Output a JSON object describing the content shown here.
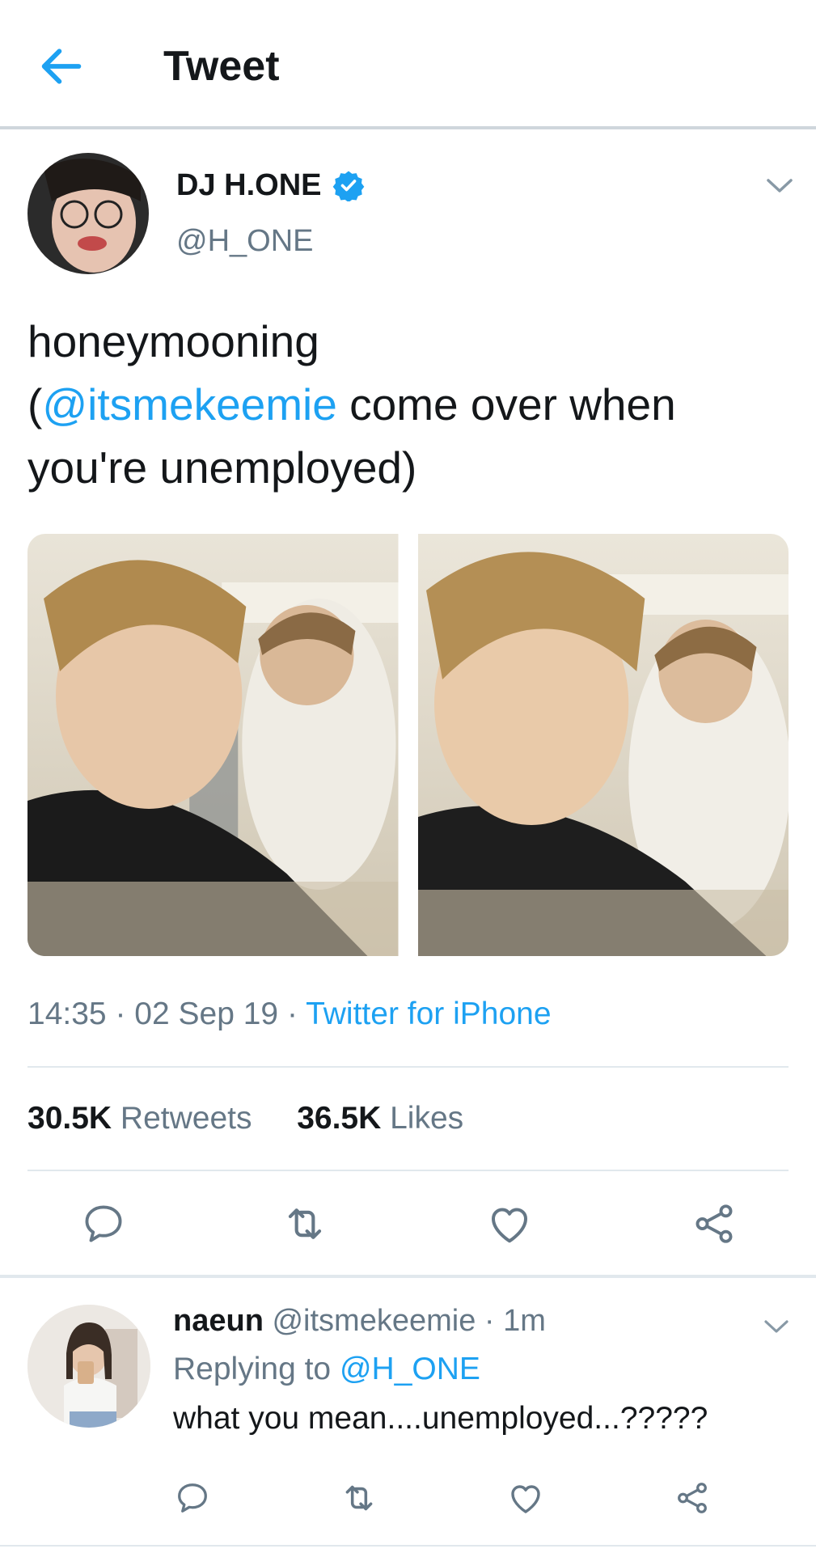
{
  "header": {
    "title": "Tweet"
  },
  "tweet": {
    "author_name": "DJ H.ONE",
    "author_handle": "@H_ONE",
    "text_line1": "honeymooning",
    "text_paren_open": "(",
    "text_mention": "@itsmekeemie",
    "text_rest": " come over when",
    "text_line3": "you're unemployed)",
    "time": "14:35",
    "sep1": " · ",
    "date": "02 Sep 19",
    "sep2": " · ",
    "source": "Twitter for iPhone",
    "retweets_count": "30.5K",
    "retweets_label": "Retweets",
    "likes_count": "36.5K",
    "likes_label": "Likes"
  },
  "reply": {
    "name": "naeun",
    "handle": "@itsmekeemie",
    "sep": " · ",
    "time": "1m",
    "replying_label": "Replying to ",
    "replying_handle": "@H_ONE",
    "text": "what you mean....unemployed...?????"
  },
  "colors": {
    "accent": "#1da1f2",
    "secondary_text": "#657786",
    "icon_gray": "#657786",
    "divider": "#e1e8ed"
  },
  "icons": {
    "back": "arrow-left-icon",
    "verified": "verified-badge-icon",
    "more": "chevron-down-icon",
    "reply": "comment-icon",
    "retweet": "retweet-icon",
    "like": "heart-icon",
    "share": "share-icon"
  }
}
